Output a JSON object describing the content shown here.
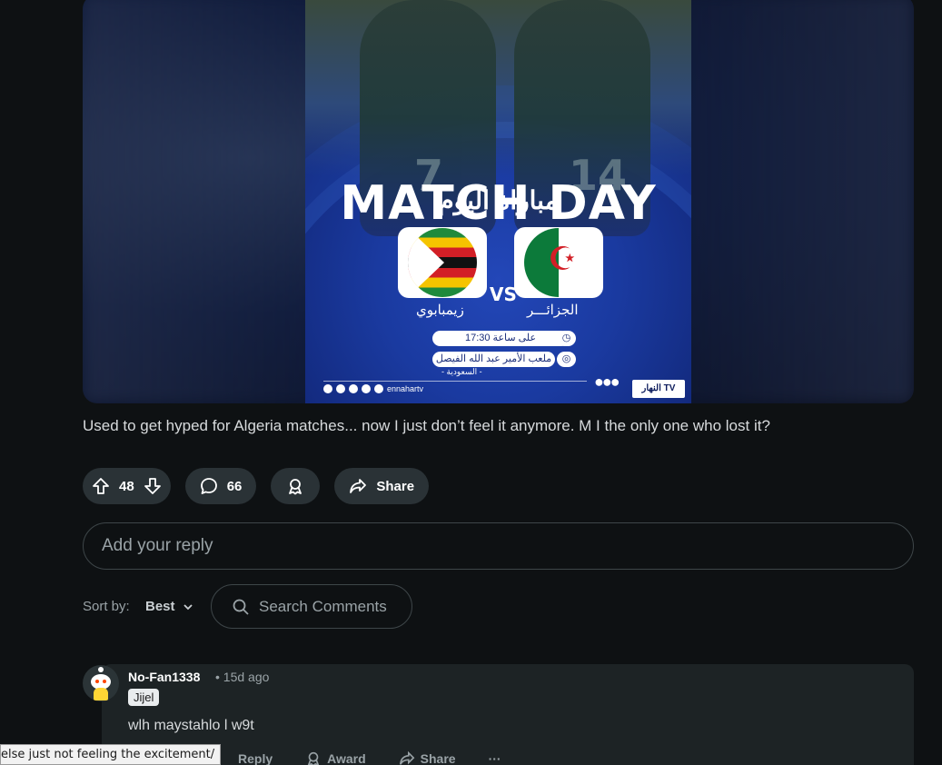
{
  "post": {
    "image": {
      "headline": "MATCH DAY",
      "headline_ar": "مباراة اليوم",
      "team_left_ar": "زيمبابوي",
      "team_right_ar": "الجزائـــر",
      "vs": "VS",
      "time_text": "على ساعة 17:30",
      "venue_text": "ملعب الأمير عبد الله الفيصل",
      "country_text": "- السعودية -",
      "social_handle": "ennahartv",
      "channel_logo": "النهار TV",
      "jersey_left": "7",
      "jersey_right": "14"
    },
    "body": "Used to get hyped for Algeria matches... now I just don’t feel it anymore. M I the only one who lost it?",
    "actions": {
      "vote_count": "48",
      "comment_count": "66",
      "share_label": "Share"
    }
  },
  "reply": {
    "placeholder": "Add your reply"
  },
  "sort": {
    "label": "Sort by:",
    "value": "Best"
  },
  "search": {
    "placeholder": "Search Comments"
  },
  "comments": [
    {
      "username": "No-Fan1338",
      "time": "• 15d ago",
      "flair": "Jijel",
      "body": "wlh maystahlo l w9t",
      "actions": {
        "reply": "Reply",
        "award": "Award",
        "share": "Share",
        "more": "···"
      }
    }
  ],
  "status_tooltip": "else just not feeling the excitement/",
  "colors": {
    "background": "#0e1113",
    "pill": "#2a3236",
    "card": "#1d2325",
    "accent_orange": "#ff4500"
  }
}
